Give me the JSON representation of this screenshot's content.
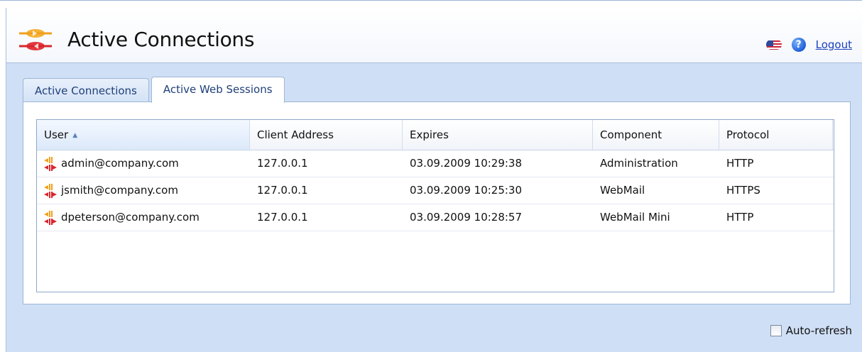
{
  "header": {
    "title": "Active Connections",
    "logo_icon": "connections-logo-icon",
    "flag_icon": "us-flag-icon",
    "help_icon": "help-icon",
    "help_glyph": "?",
    "logout_label": "Logout"
  },
  "tabs": [
    {
      "label": "Active Connections",
      "active": false
    },
    {
      "label": "Active Web Sessions",
      "active": true
    }
  ],
  "grid": {
    "columns": [
      "User",
      "Client Address",
      "Expires",
      "Component",
      "Protocol"
    ],
    "sorted_column": "User",
    "sort_direction": "ascending",
    "rows": [
      {
        "user": "admin@company.com",
        "client_address": "127.0.0.1",
        "expires": "03.09.2009 10:29:38",
        "component": "Administration",
        "protocol": "HTTP"
      },
      {
        "user": "jsmith@company.com",
        "client_address": "127.0.0.1",
        "expires": "03.09.2009 10:25:30",
        "component": "WebMail",
        "protocol": "HTTPS"
      },
      {
        "user": "dpeterson@company.com",
        "client_address": "127.0.0.1",
        "expires": "03.09.2009 10:28:57",
        "component": "WebMail Mini",
        "protocol": "HTTP"
      }
    ]
  },
  "footer": {
    "auto_refresh_label": "Auto-refresh",
    "auto_refresh_checked": false
  },
  "colors": {
    "content_bg": "#cfdff5",
    "accent_link": "#1a3fbf",
    "icon_orange": "#f0a01e",
    "icon_red": "#d8262c"
  }
}
